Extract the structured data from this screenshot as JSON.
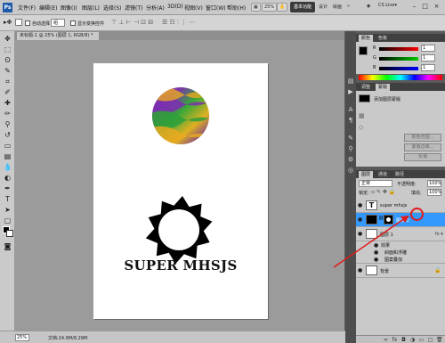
{
  "menubar": {
    "logo": "Ps",
    "menus": [
      "文件(F)",
      "编辑(E)",
      "图像(I)",
      "图层(L)",
      "选择(S)",
      "滤镜(T)",
      "分析(A)",
      "3D(D)",
      "视图(V)",
      "窗口(W)",
      "帮助(H)"
    ],
    "zoom": "25%",
    "workspace_active": "基本功能",
    "workspace_design": "设计",
    "workspace_painting": "绘画",
    "more": "»",
    "cs_live": "CS Live▾"
  },
  "options": {
    "auto_select_label": "自动选择",
    "auto_select_value": "组",
    "show_transform_label": "显示变换控件"
  },
  "document": {
    "tab_title": "未标题-1 @ 25% (图层 1, RGB/8) *",
    "text_content": "SUPER MHSJS"
  },
  "status": {
    "zoom": "25%",
    "doc_info": "文档:24.9M/8.29M"
  },
  "color_panel": {
    "tabs": [
      "颜色",
      "色板"
    ],
    "r_label": "R",
    "g_label": "G",
    "b_label": "B",
    "r": "1",
    "g": "1",
    "b": "1"
  },
  "adjust_panel": {
    "tabs": [
      "调整",
      "蒙版"
    ],
    "title": "添加图层蒙版",
    "buttons": [
      "像素蒙版",
      "矢量蒙版",
      "颜色范围...",
      "蒙版边缘...",
      "反相"
    ]
  },
  "layers_panel": {
    "tabs": [
      "图层",
      "通道",
      "路径"
    ],
    "blend_mode": "正常",
    "opacity_label": "不透明度:",
    "opacity": "100%",
    "lock_label": "锁定:",
    "fill_label": "填充:",
    "fill": "100%",
    "layers": [
      {
        "name": "super mhsjs",
        "type": "text"
      },
      {
        "name": "图层 2",
        "type": "selected"
      },
      {
        "name": "图层 1",
        "type": "effects"
      },
      {
        "name": "背景",
        "type": "background"
      }
    ],
    "effects_label": "效果",
    "effect_items": [
      "斜面和浮雕",
      "图案叠加"
    ]
  },
  "colors": {
    "accent": "#3399ff",
    "annotation": "#e01b1b"
  }
}
